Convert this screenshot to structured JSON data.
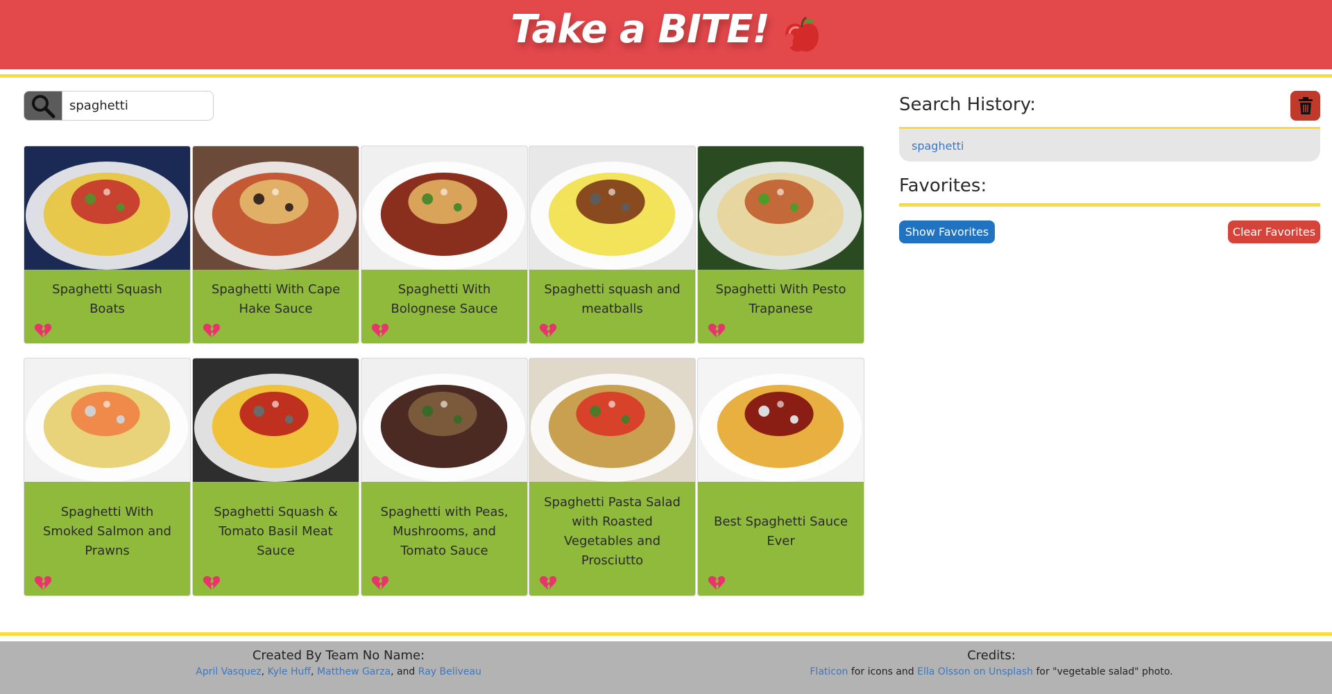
{
  "header": {
    "title": "Take a BITE!"
  },
  "search": {
    "value": "spaghetti",
    "button_icon": "search-icon"
  },
  "recipes": [
    {
      "title": "Spaghetti Squash Boats",
      "icon": "broken-heart-icon"
    },
    {
      "title": "Spaghetti With Cape Hake Sauce",
      "icon": "broken-heart-icon"
    },
    {
      "title": "Spaghetti With Bolognese Sauce",
      "icon": "broken-heart-icon"
    },
    {
      "title": "Spaghetti squash and meatballs",
      "icon": "broken-heart-icon"
    },
    {
      "title": "Spaghetti With Pesto Trapanese",
      "icon": "broken-heart-icon"
    },
    {
      "title": "Spaghetti With Smoked Salmon and Prawns",
      "icon": "broken-heart-icon"
    },
    {
      "title": "Spaghetti Squash & Tomato Basil Meat Sauce",
      "icon": "broken-heart-icon"
    },
    {
      "title": "Spaghetti with Peas, Mushrooms, and Tomato Sauce",
      "icon": "broken-heart-icon"
    },
    {
      "title": "Spaghetti Pasta Salad with Roasted Vegetables and Prosciutto",
      "icon": "broken-heart-icon"
    },
    {
      "title": "Best Spaghetti Sauce Ever",
      "icon": "broken-heart-icon"
    }
  ],
  "sidebar": {
    "history_title": "Search History:",
    "history_items": [
      "spaghetti"
    ],
    "favorites_title": "Favorites:",
    "show_favorites": "Show Favorites",
    "clear_favorites": "Clear Favorites"
  },
  "footer": {
    "created_title": "Created By Team No Name:",
    "authors": [
      "April Vasquez",
      "Kyle Huff",
      "Matthew Garza",
      "Ray Beliveau"
    ],
    "sep1": ",",
    "sep2": ",",
    "sep3": ", and",
    "credits_title": "Credits:",
    "credit_link1": "Flaticon",
    "credit_text1": "for icons and",
    "credit_link2": "Ella Olsson on Unsplash",
    "credit_text2": "for \"vegetable salad\" photo."
  },
  "colors": {
    "header_red": "#e3484b",
    "accent_yellow": "#f8dc3a",
    "card_green": "#8fba3c",
    "link_blue": "#3c78c0",
    "show_btn_blue": "#1f73c0",
    "clear_btn_red": "#d4443a",
    "heart_pink": "#e8336b"
  }
}
